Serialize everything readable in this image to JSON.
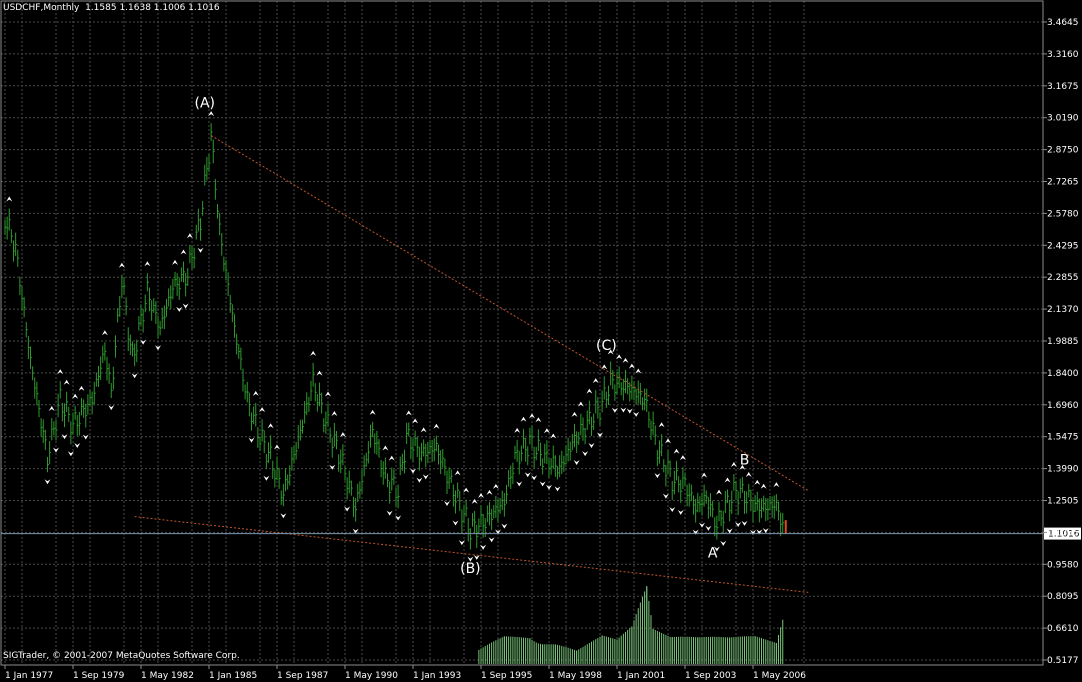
{
  "header": {
    "symbol": "USDCHF,Monthly",
    "ohlc": "1.1585 1.1638 1.1006 1.1016"
  },
  "footer": {
    "copyright": "SIGTrader, © 2001-2007 MetaQuotes Software Corp."
  },
  "colors": {
    "background": "#000000",
    "grid": "#4a4a4a",
    "frame": "#8c8c8c",
    "price": "#2e9a2e",
    "volume": "#7bc47b",
    "trendline": "#c0552c",
    "current_price_line": "#7a97b0",
    "fractal": "#ffffff",
    "last_bar_up": "#e24a1e"
  },
  "chart_data": {
    "type": "bar",
    "title": "USDCHF,Monthly",
    "ylim": [
      0.5177,
      3.4645
    ],
    "y_ticks": [
      "3.4645",
      "3.3160",
      "3.1675",
      "3.0190",
      "2.8750",
      "2.7265",
      "2.5780",
      "2.4295",
      "2.2855",
      "2.1370",
      "1.9885",
      "1.8400",
      "1.6960",
      "1.5475",
      "1.3990",
      "1.2505",
      "1.1065",
      "0.9580",
      "0.8095",
      "0.6610",
      "0.5177"
    ],
    "x_ticks": [
      "1 Jan 1977",
      "1 Sep 1979",
      "1 May 1982",
      "1 Jan 1985",
      "1 Sep 1987",
      "1 May 1990",
      "1 Jan 1993",
      "1 Sep 1995",
      "1 May 1998",
      "1 Jan 2001",
      "1 Sep 2003",
      "1 May 2006"
    ],
    "current_price": "1.1016",
    "price_path": [
      {
        "date": "1977-01",
        "price": 2.56
      },
      {
        "date": "1977-06",
        "price": 2.42
      },
      {
        "date": "1978-01",
        "price": 1.9
      },
      {
        "date": "1978-09",
        "price": 1.45
      },
      {
        "date": "1979-03",
        "price": 1.72
      },
      {
        "date": "1979-09",
        "price": 1.6
      },
      {
        "date": "1980-06",
        "price": 1.72
      },
      {
        "date": "1980-12",
        "price": 1.95
      },
      {
        "date": "1981-03",
        "price": 1.75
      },
      {
        "date": "1981-08",
        "price": 2.28
      },
      {
        "date": "1982-01",
        "price": 1.9
      },
      {
        "date": "1982-08",
        "price": 2.22
      },
      {
        "date": "1983-02",
        "price": 2.05
      },
      {
        "date": "1983-08",
        "price": 2.24
      },
      {
        "date": "1984-03",
        "price": 2.3
      },
      {
        "date": "1984-09",
        "price": 2.55
      },
      {
        "date": "1985-02",
        "price": 2.94
      },
      {
        "date": "1985-06",
        "price": 2.5
      },
      {
        "date": "1986-01",
        "price": 2.05
      },
      {
        "date": "1986-07",
        "price": 1.72
      },
      {
        "date": "1987-01",
        "price": 1.55
      },
      {
        "date": "1987-06",
        "price": 1.45
      },
      {
        "date": "1987-12",
        "price": 1.28
      },
      {
        "date": "1988-06",
        "price": 1.5
      },
      {
        "date": "1989-02",
        "price": 1.8
      },
      {
        "date": "1989-08",
        "price": 1.62
      },
      {
        "date": "1990-03",
        "price": 1.45
      },
      {
        "date": "1990-10",
        "price": 1.22
      },
      {
        "date": "1991-06",
        "price": 1.58
      },
      {
        "date": "1991-12",
        "price": 1.36
      },
      {
        "date": "1992-06",
        "price": 1.3
      },
      {
        "date": "1992-10",
        "price": 1.55
      },
      {
        "date": "1993-05",
        "price": 1.47
      },
      {
        "date": "1993-12",
        "price": 1.5
      },
      {
        "date": "1994-06",
        "price": 1.35
      },
      {
        "date": "1995-04",
        "price": 1.12
      },
      {
        "date": "1995-10",
        "price": 1.15
      },
      {
        "date": "1996-03",
        "price": 1.2
      },
      {
        "date": "1996-08",
        "price": 1.25
      },
      {
        "date": "1997-01",
        "price": 1.45
      },
      {
        "date": "1997-08",
        "price": 1.52
      },
      {
        "date": "1998-03",
        "price": 1.45
      },
      {
        "date": "1998-10",
        "price": 1.4
      },
      {
        "date": "1999-04",
        "price": 1.52
      },
      {
        "date": "1999-12",
        "price": 1.62
      },
      {
        "date": "2000-06",
        "price": 1.7
      },
      {
        "date": "2000-10",
        "price": 1.8
      },
      {
        "date": "2001-06",
        "price": 1.78
      },
      {
        "date": "2002-02",
        "price": 1.72
      },
      {
        "date": "2002-08",
        "price": 1.5
      },
      {
        "date": "2003-03",
        "price": 1.35
      },
      {
        "date": "2003-09",
        "price": 1.33
      },
      {
        "date": "2004-02",
        "price": 1.22
      },
      {
        "date": "2004-07",
        "price": 1.27
      },
      {
        "date": "2004-12",
        "price": 1.14
      },
      {
        "date": "2005-04",
        "price": 1.22
      },
      {
        "date": "2005-09",
        "price": 1.3
      },
      {
        "date": "2006-01",
        "price": 1.28
      },
      {
        "date": "2006-06",
        "price": 1.23
      },
      {
        "date": "2006-12",
        "price": 1.22
      },
      {
        "date": "2007-03",
        "price": 1.24
      },
      {
        "date": "2007-06",
        "price": 1.18
      },
      {
        "date": "2007-08",
        "price": 1.1
      }
    ],
    "trendlines": [
      {
        "from": {
          "date": "1985-02",
          "price": 2.94
        },
        "to": {
          "date": "2008-07",
          "price": 1.3
        }
      },
      {
        "from": {
          "date": "1982-02",
          "price": 1.18
        },
        "to": {
          "date": "2008-07",
          "price": 0.83
        }
      }
    ],
    "wave_labels": [
      {
        "text": "(A)",
        "date": "1984-11",
        "price": 3.07
      },
      {
        "text": "(B)",
        "date": "1995-04",
        "price": 0.92
      },
      {
        "text": "(C)",
        "date": "2000-08",
        "price": 1.95
      },
      {
        "text": "A",
        "date": "2004-10",
        "price": 0.99
      },
      {
        "text": "B",
        "date": "2006-01",
        "price": 1.42
      }
    ],
    "volume_bars": [
      {
        "date": "1995-08",
        "relative": 0.15
      },
      {
        "date": "1996-08",
        "relative": 0.32
      },
      {
        "date": "1997-08",
        "relative": 0.36
      },
      {
        "date": "1998-02",
        "relative": 0.28
      },
      {
        "date": "1998-08",
        "relative": 0.25
      },
      {
        "date": "1999-06",
        "relative": 0.15
      },
      {
        "date": "2000-06",
        "relative": 0.3
      },
      {
        "date": "2001-01",
        "relative": 0.26
      },
      {
        "date": "2001-08",
        "relative": 0.42
      },
      {
        "date": "2002-03",
        "relative": 0.95
      },
      {
        "date": "2002-06",
        "relative": 0.45
      },
      {
        "date": "2003-03",
        "relative": 0.4
      },
      {
        "date": "2004-03",
        "relative": 0.32
      },
      {
        "date": "2005-06",
        "relative": 0.28
      },
      {
        "date": "2006-06",
        "relative": 0.3
      },
      {
        "date": "2007-04",
        "relative": 0.25
      },
      {
        "date": "2007-07",
        "relative": 0.55
      }
    ]
  }
}
